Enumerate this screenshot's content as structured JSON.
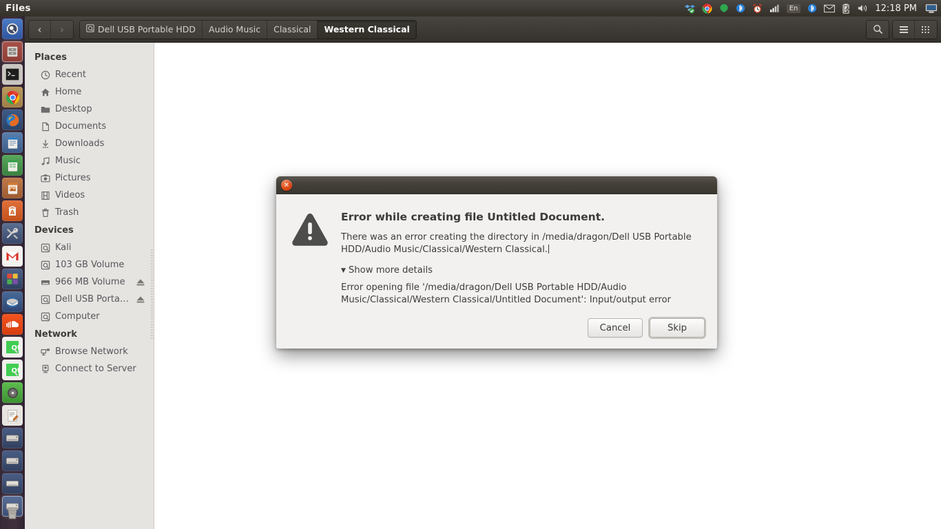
{
  "topbar": {
    "app_menu_title": "Files",
    "clock": "12:18 PM",
    "tray_items": [
      {
        "name": "dropbox-icon",
        "label": "Dropbox"
      },
      {
        "name": "chrome-icon",
        "label": "Google Chrome"
      },
      {
        "name": "green-dot-icon",
        "label": "Status"
      },
      {
        "name": "bluetooth-icon",
        "label": "Bluetooth"
      },
      {
        "name": "alarm-clock-icon",
        "label": "Alarm clock"
      },
      {
        "name": "signal-bars-icon",
        "label": "Network signal"
      },
      {
        "name": "keyboard-layout-icon",
        "label": "En"
      },
      {
        "name": "bluetooth-indicator-icon",
        "label": "Bluetooth"
      },
      {
        "name": "mail-icon",
        "label": "Messaging"
      },
      {
        "name": "battery-icon",
        "label": "Battery charging"
      },
      {
        "name": "volume-icon",
        "label": "Volume"
      },
      {
        "name": "display-icon",
        "label": "Display"
      }
    ]
  },
  "launcher": {
    "items": [
      {
        "name": "launcher-dash",
        "label": "Dash",
        "glyph": "",
        "focused": false,
        "running": false
      },
      {
        "name": "launcher-files",
        "label": "Files",
        "glyph": "",
        "focused": true,
        "running": true
      },
      {
        "name": "launcher-terminal",
        "label": "Terminal",
        "glyph": "",
        "focused": false,
        "running": false
      },
      {
        "name": "launcher-chrome",
        "label": "Google Chrome",
        "glyph": "",
        "focused": false,
        "running": true
      },
      {
        "name": "launcher-firefox",
        "label": "Firefox",
        "glyph": "",
        "focused": false,
        "running": false
      },
      {
        "name": "launcher-libreoffice-writer",
        "label": "LibreOffice Writer",
        "glyph": "",
        "focused": false,
        "running": false
      },
      {
        "name": "launcher-libreoffice-calc",
        "label": "LibreOffice Calc",
        "glyph": "",
        "focused": false,
        "running": false
      },
      {
        "name": "launcher-libreoffice-impress",
        "label": "LibreOffice Impress",
        "glyph": "",
        "focused": false,
        "running": false
      },
      {
        "name": "launcher-ubuntu-software",
        "label": "Ubuntu Software",
        "glyph": "A",
        "focused": false,
        "running": false
      },
      {
        "name": "launcher-system-tools",
        "label": "System Tools",
        "glyph": "",
        "focused": false,
        "running": false
      },
      {
        "name": "launcher-gmail",
        "label": "Gmail",
        "glyph": "M",
        "focused": false,
        "running": false
      },
      {
        "name": "launcher-applications",
        "label": "Applications",
        "glyph": "",
        "focused": false,
        "running": false
      },
      {
        "name": "launcher-thunderbird",
        "label": "Thunderbird",
        "glyph": "",
        "focused": false,
        "running": false
      },
      {
        "name": "launcher-soundcloud",
        "label": "SoundCloud",
        "glyph": "",
        "focused": false,
        "running": false
      },
      {
        "name": "launcher-qt-creator-1",
        "label": "Qt Creator",
        "glyph": "Qt",
        "focused": false,
        "running": false
      },
      {
        "name": "launcher-qt-creator-2",
        "label": "Qt Creator",
        "glyph": "Qt",
        "focused": false,
        "running": false
      },
      {
        "name": "launcher-disc",
        "label": "Disc",
        "glyph": "",
        "focused": false,
        "running": false
      },
      {
        "name": "launcher-text-editor",
        "label": "Text Editor",
        "glyph": "",
        "focused": false,
        "running": false
      },
      {
        "name": "launcher-drive-1",
        "label": "Kali",
        "glyph": "",
        "focused": false,
        "running": false
      },
      {
        "name": "launcher-drive-2",
        "label": "103 GB Volume",
        "glyph": "",
        "focused": false,
        "running": false
      },
      {
        "name": "launcher-drive-3",
        "label": "966 MB Volume",
        "glyph": "",
        "focused": false,
        "running": false
      },
      {
        "name": "launcher-drive-4",
        "label": "Dell USB Portable HDD",
        "glyph": "",
        "focused": true,
        "running": false
      }
    ],
    "trash_label": "Trash"
  },
  "toolbar": {
    "back_label": "‹",
    "forward_label": "›",
    "breadcrumbs": [
      {
        "label": "Dell USB Portable HDD",
        "icon": "drive-icon",
        "active": false
      },
      {
        "label": "Audio Music",
        "icon": "",
        "active": false
      },
      {
        "label": "Classical",
        "icon": "",
        "active": false
      },
      {
        "label": "Western Classical",
        "icon": "",
        "active": true
      }
    ],
    "search_label": "Search",
    "menu_label": "Menu",
    "view_label": "View options"
  },
  "sidebar": {
    "sections": [
      {
        "heading": "Places",
        "items": [
          {
            "label": "Recent",
            "icon": "clock-icon",
            "eject": false
          },
          {
            "label": "Home",
            "icon": "home-icon",
            "eject": false
          },
          {
            "label": "Desktop",
            "icon": "folder-icon",
            "eject": false
          },
          {
            "label": "Documents",
            "icon": "document-icon",
            "eject": false
          },
          {
            "label": "Downloads",
            "icon": "download-icon",
            "eject": false
          },
          {
            "label": "Music",
            "icon": "music-note-icon",
            "eject": false
          },
          {
            "label": "Pictures",
            "icon": "camera-icon",
            "eject": false
          },
          {
            "label": "Videos",
            "icon": "film-icon",
            "eject": false
          },
          {
            "label": "Trash",
            "icon": "trash-icon",
            "eject": false
          }
        ]
      },
      {
        "heading": "Devices",
        "items": [
          {
            "label": "Kali",
            "icon": "harddisk-icon",
            "eject": false
          },
          {
            "label": "103 GB Volume",
            "icon": "harddisk-icon",
            "eject": false
          },
          {
            "label": "966 MB Volume",
            "icon": "drive-removable-icon",
            "eject": true
          },
          {
            "label": "Dell USB Porta…",
            "icon": "harddisk-icon",
            "eject": true
          },
          {
            "label": "Computer",
            "icon": "harddisk-icon",
            "eject": false
          }
        ]
      },
      {
        "heading": "Network",
        "items": [
          {
            "label": "Browse Network",
            "icon": "network-icon",
            "eject": false
          },
          {
            "label": "Connect to Server",
            "icon": "server-icon",
            "eject": false
          }
        ]
      }
    ]
  },
  "dialog": {
    "close_label": "×",
    "heading": "Error while creating file Untitled Document.",
    "message": "There was an error creating the directory in /media/dragon/Dell USB Portable HDD/Audio Music/Classical/Western Classical.",
    "show_more_label": "Show more details",
    "details_triangle": "▼",
    "details": "Error opening file '/media/dragon/Dell USB Portable HDD/Audio Music/Classical/Western Classical/Untitled Document': Input/output error",
    "cancel_label": "Cancel",
    "skip_label": "Skip"
  },
  "colors": {
    "accent_orange": "#dd4814",
    "topbar": "#3c3833",
    "sidebar_bg": "#e6e4e1",
    "dialog_bg": "#f2f1f0"
  }
}
